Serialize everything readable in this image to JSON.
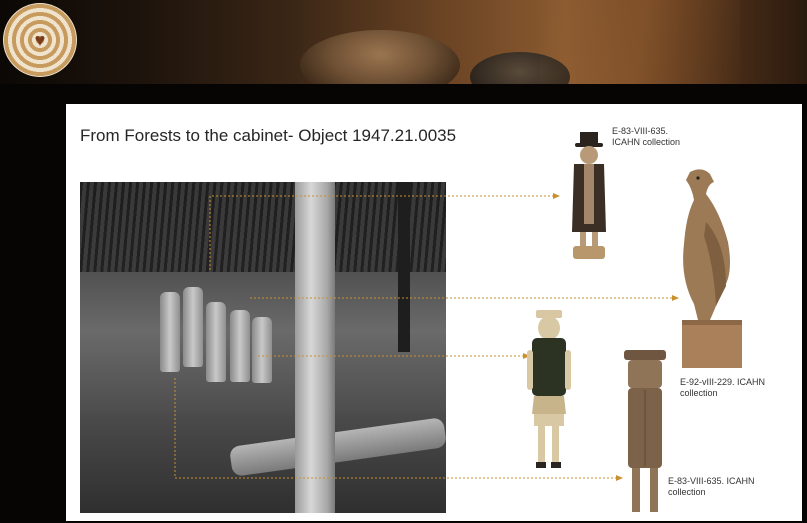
{
  "colors": {
    "slide_background": "#ffffff",
    "connector": "#c9902e",
    "page_background": "#060504"
  },
  "header": {
    "logo_icon": "heart-target-icon"
  },
  "slide": {
    "title": "From Forests to the cabinet- Object 1947.21.0035",
    "labels": {
      "top": "E-83-VIII-635. ICAHN collection",
      "middle": "E-92-vIII-229. ICAHN collection",
      "bottom": "E-83-VIII-635. ICAHN collection"
    },
    "images": [
      "field-photograph",
      "top-hat-figure-statue",
      "eagle-statue",
      "painted-figure-statue",
      "cylinder-figure-statue"
    ]
  }
}
